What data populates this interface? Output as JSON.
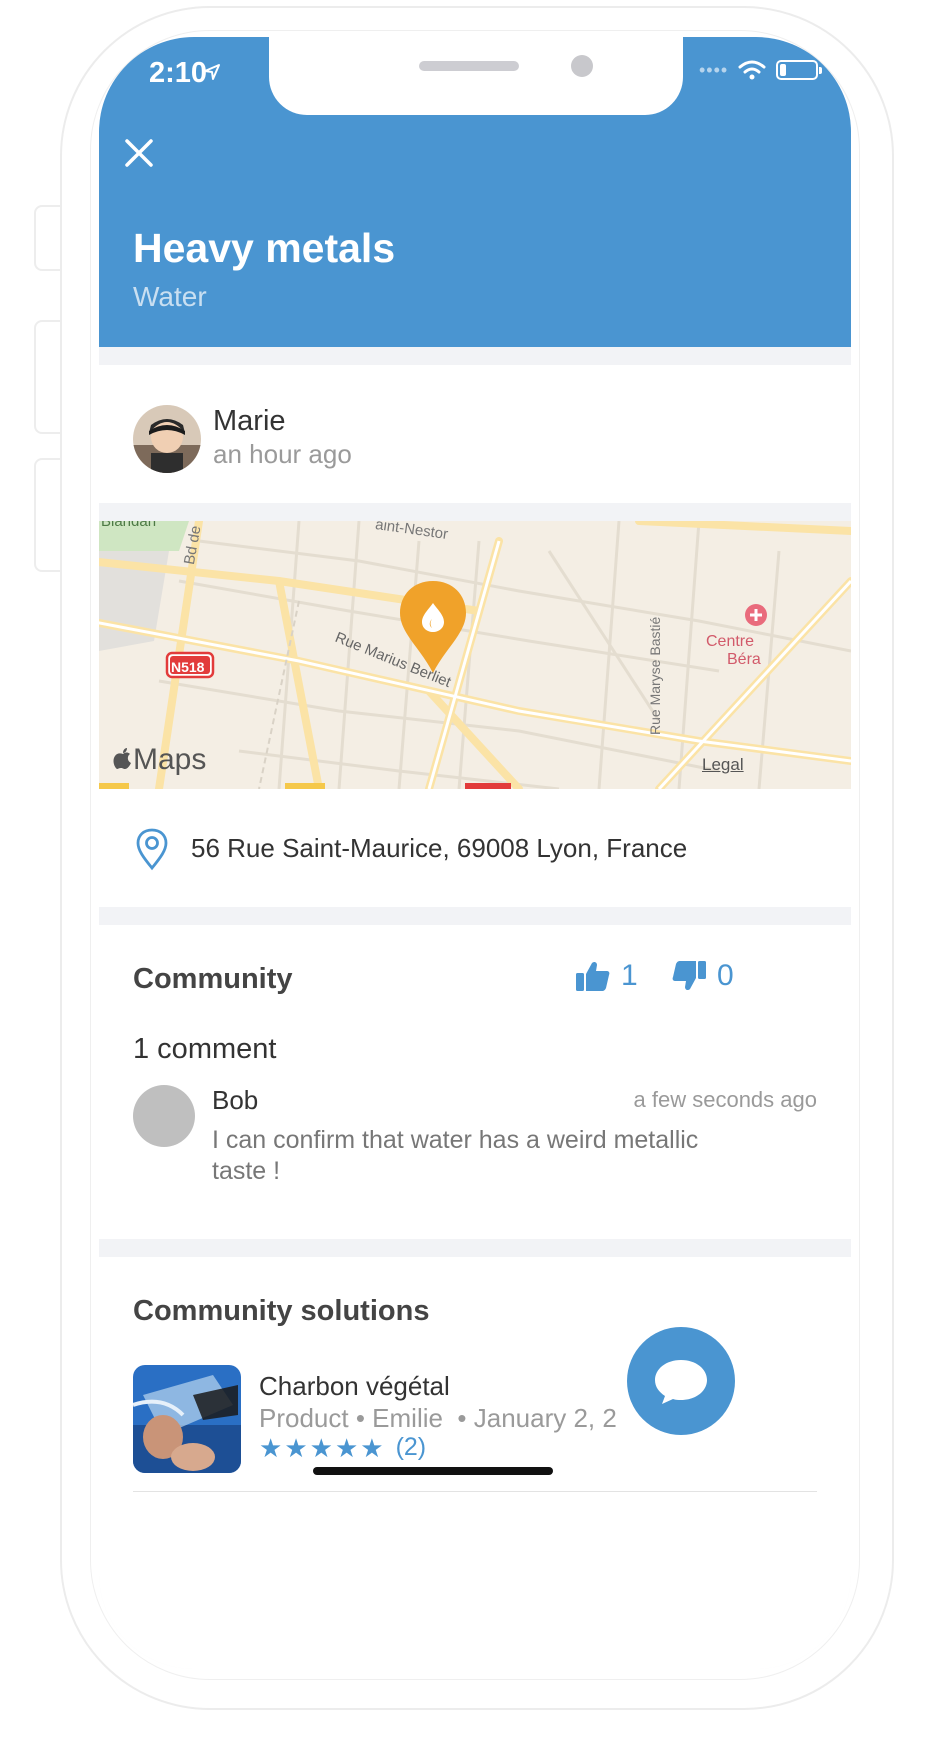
{
  "status_bar": {
    "time": "2:10"
  },
  "header": {
    "title": "Heavy metals",
    "subtitle": "Water",
    "close_icon": "close-icon"
  },
  "author": {
    "name": "Marie",
    "time": "an hour ago"
  },
  "map": {
    "logo_text": "Maps",
    "legal": "Legal",
    "labels": {
      "road_badge": "N518",
      "street_1": "Rue Marius Berliet",
      "street_2": "Rue Maryse Bastié",
      "street_3": "aint-Nestor",
      "street_4": "Bd de",
      "poi": "Centre",
      "poi_2": "Béra",
      "park": "Blandan"
    },
    "colors": {
      "pin": "#f0a22a",
      "road": "#fbe3a6",
      "park": "#cfe6c2"
    }
  },
  "address": {
    "text": "56 Rue Saint-Maurice, 69008 Lyon, France"
  },
  "community": {
    "title": "Community",
    "upvotes": "1",
    "downvotes": "0",
    "comment_count": "1 comment",
    "comments": [
      {
        "author": "Bob",
        "time": "a few seconds ago",
        "text": "I can confirm that water has a weird metallic taste !"
      }
    ]
  },
  "solutions": {
    "title": "Community solutions",
    "items": [
      {
        "name": "Charbon végétal",
        "type": "Product",
        "author": "Emilie",
        "date": "January 2, 2",
        "rating": 5,
        "rating_count": "(2)"
      }
    ]
  },
  "theme": {
    "accent": "#4a95d1",
    "background": "#f2f3f6"
  }
}
